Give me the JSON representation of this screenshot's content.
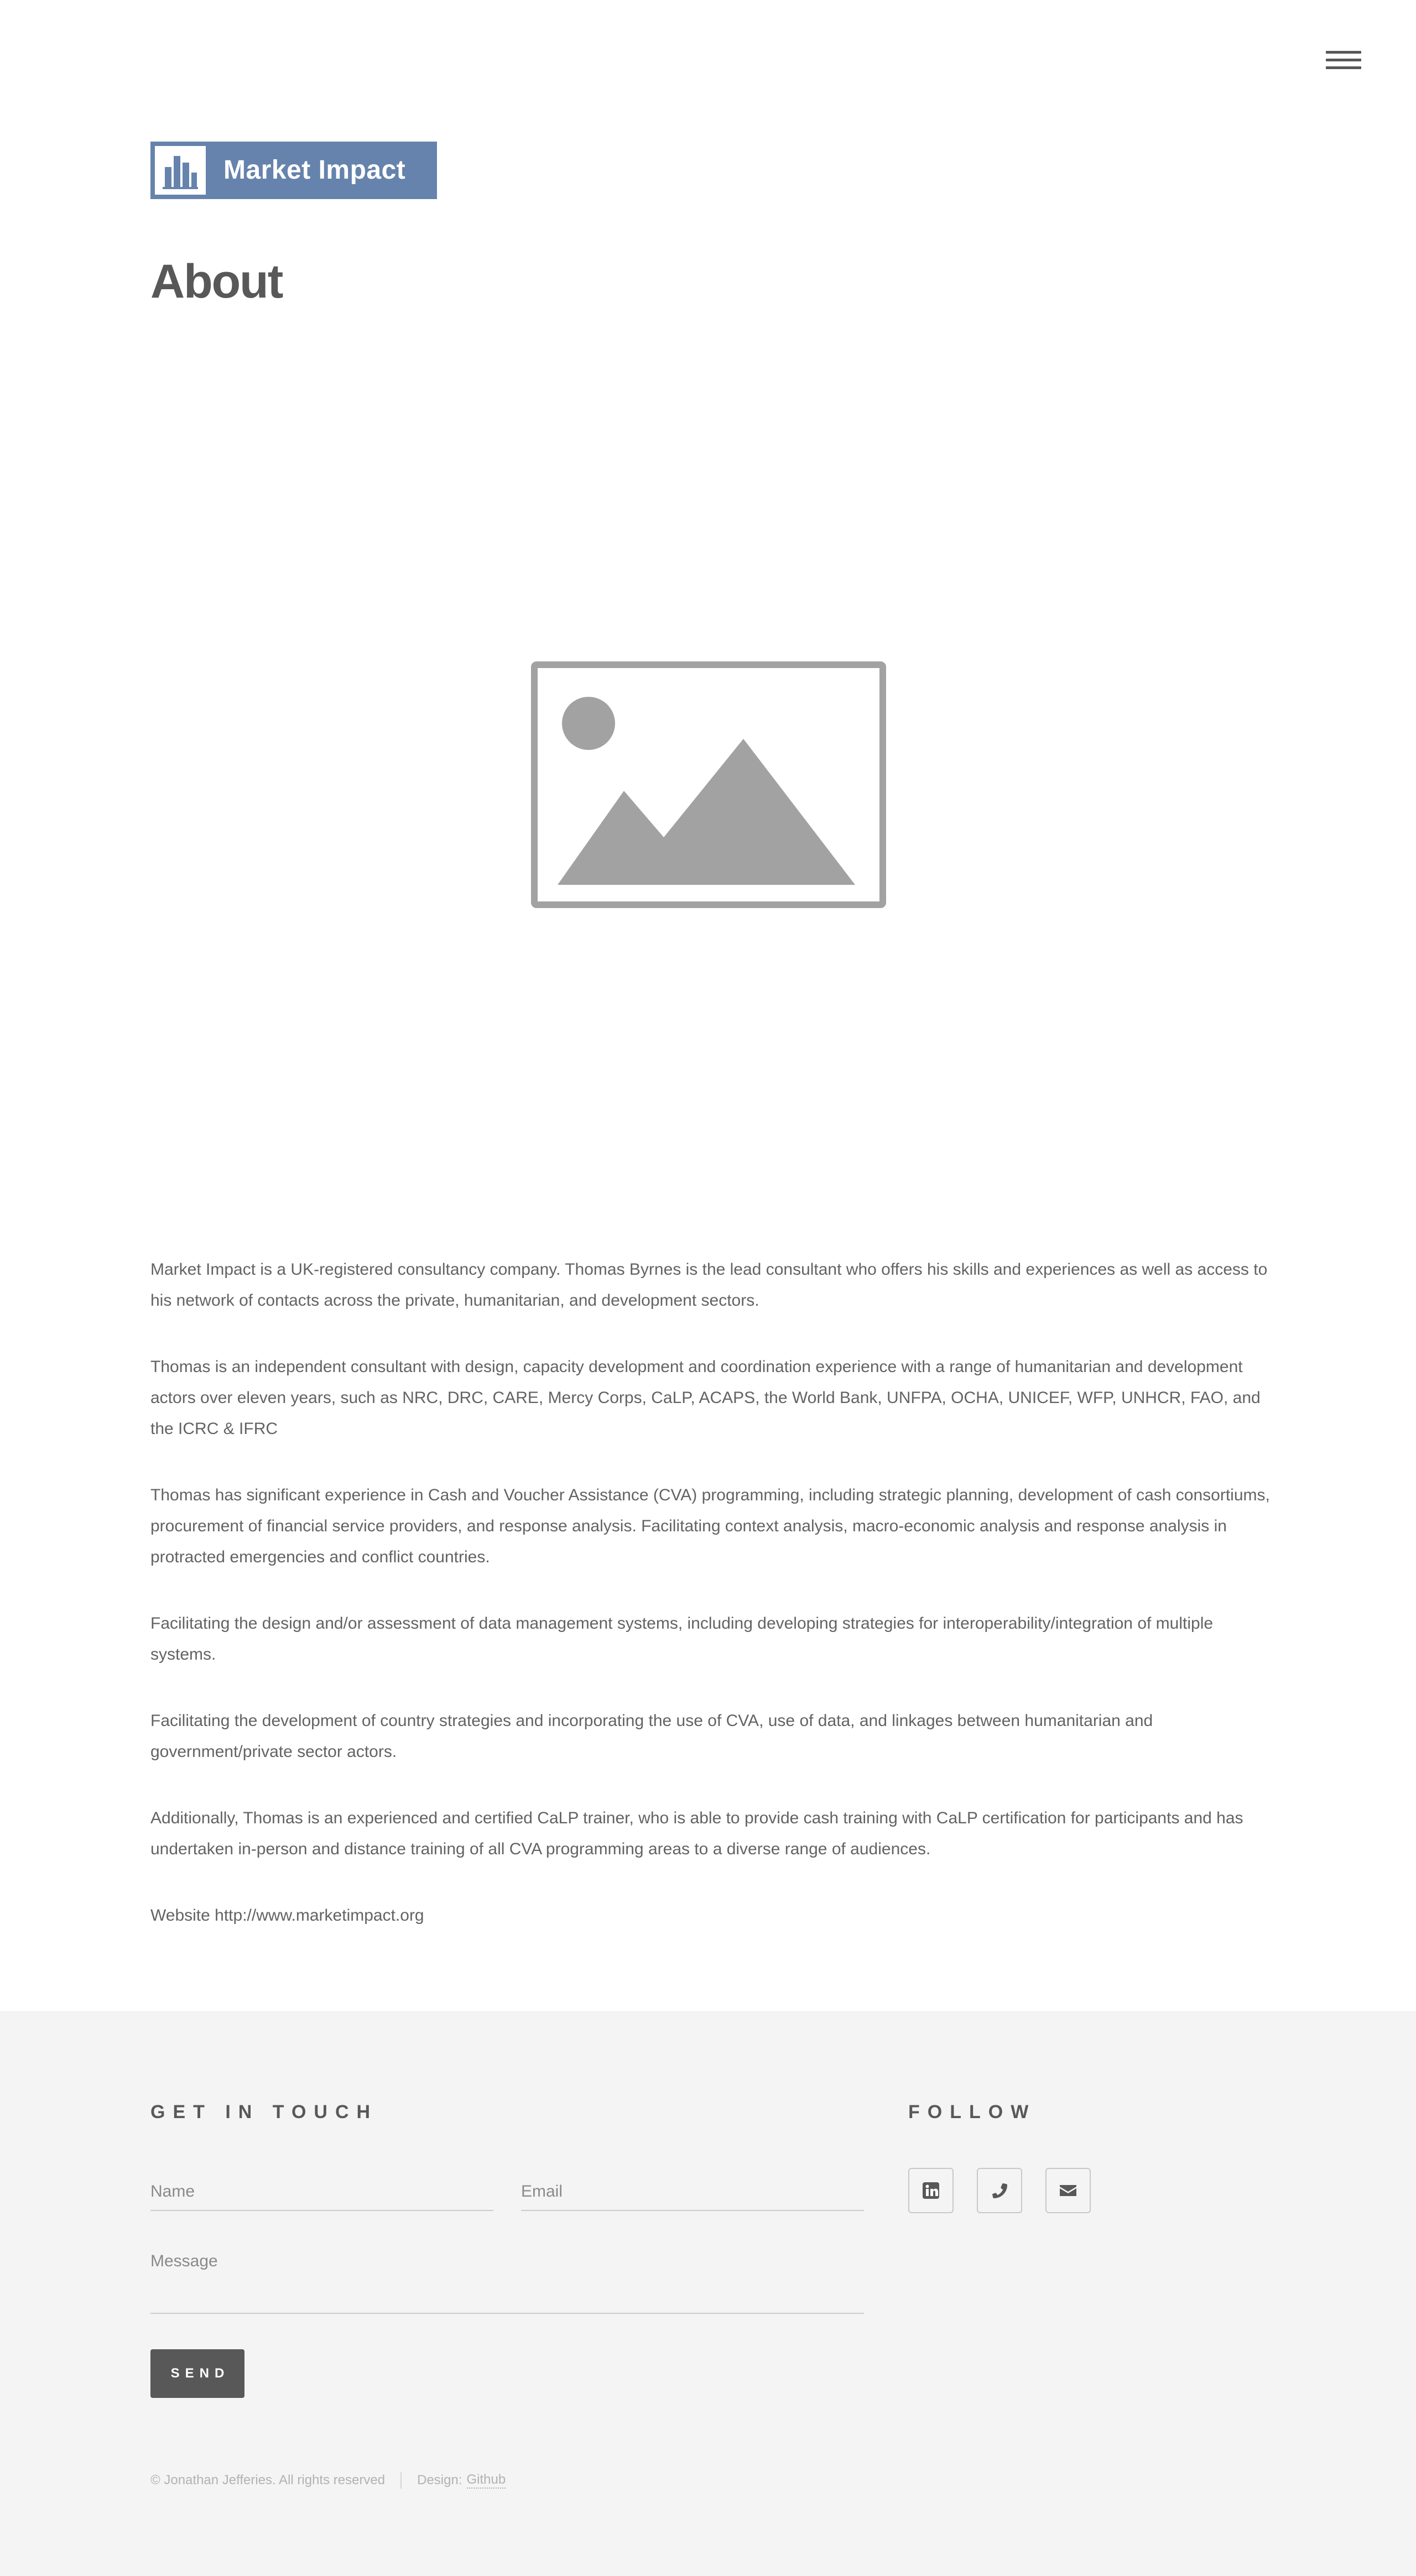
{
  "header": {
    "logo_text": "Market Impact",
    "menu_icon": "hamburger-menu-icon"
  },
  "page": {
    "title": "About",
    "hero_image_icon": "image-placeholder-icon"
  },
  "content": {
    "paragraphs": [
      "Market Impact is a UK-registered consultancy company. Thomas Byrnes is the lead consultant who offers his skills and experiences as well as access to his network of contacts across the private, humanitarian, and development sectors.",
      "Thomas is an independent consultant with design, capacity development and coordination experience with a range of humanitarian and development actors over eleven years, such as NRC, DRC, CARE, Mercy Corps, CaLP, ACAPS, the World Bank, UNFPA, OCHA, UNICEF, WFP, UNHCR, FAO, and the ICRC & IFRC",
      "Thomas has significant experience in Cash and Voucher Assistance (CVA) programming, including strategic planning, development of cash consortiums, procurement of financial service providers, and response analysis. Facilitating context analysis, macro-economic analysis and response analysis in protracted emergencies and conflict countries.",
      "Facilitating the design and/or assessment of data management systems, including developing strategies for interoperability/integration of multiple systems.",
      "Facilitating the development of country strategies and incorporating the use of CVA, use of data, and linkages between humanitarian and government/private sector actors.",
      "Additionally, Thomas is an experienced and certified CaLP trainer, who is able to provide cash training with CaLP certification for participants and has undertaken in-person and distance training of all CVA programming areas to a diverse range of audiences.",
      "Website http://www.marketimpact.org"
    ]
  },
  "footer": {
    "contact_heading": "GET IN TOUCH",
    "follow_heading": "FOLLOW",
    "form": {
      "name_placeholder": "Name",
      "email_placeholder": "Email",
      "message_placeholder": "Message",
      "send_label": "SEND"
    },
    "social": [
      {
        "icon": "linkedin-icon"
      },
      {
        "icon": "phone-icon"
      },
      {
        "icon": "envelope-icon"
      }
    ],
    "copyright": "© Jonathan Jefferies. All rights reserved",
    "design_label": "Design:",
    "design_link": "Github"
  },
  "colors": {
    "brand": "#6583ac",
    "text": "#585858",
    "footer_bg": "#f4f4f4",
    "button": "#585858"
  }
}
